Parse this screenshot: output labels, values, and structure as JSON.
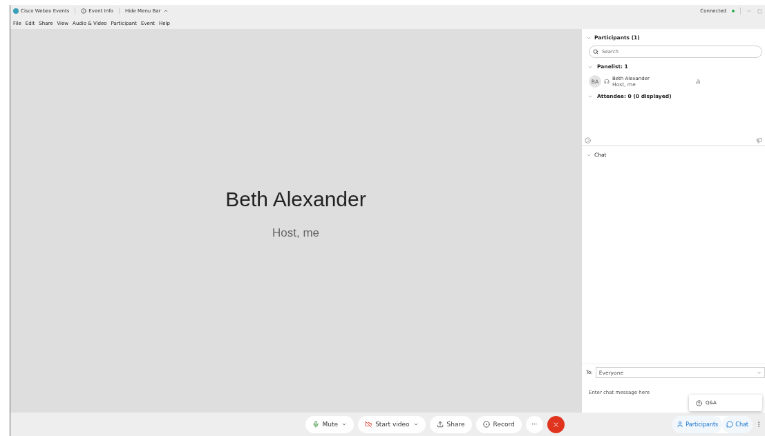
{
  "title_bar": {
    "app_name": "Cisco Webex Events",
    "event_info": "Event Info",
    "hide_menu": "Hide Menu Bar",
    "status": "Connected"
  },
  "menu": [
    "File",
    "Edit",
    "Share",
    "View",
    "Audio & Video",
    "Participant",
    "Event",
    "Help"
  ],
  "stage": {
    "name": "Beth Alexander",
    "role": "Host, me"
  },
  "participants": {
    "title": "Participants (1)",
    "expanded": true,
    "search_placeholder": "Search",
    "groups": [
      {
        "label": "Panelist: 1",
        "expanded": true,
        "members": [
          {
            "initials": "BA",
            "name": "Beth Alexander",
            "role": "Host, me"
          }
        ]
      },
      {
        "label": "Attendee: 0 (0 displayed)",
        "expanded": true
      }
    ]
  },
  "chat": {
    "title": "Chat",
    "expanded": true,
    "to_label": "To:",
    "to_value": "Everyone",
    "placeholder": "Enter chat message here"
  },
  "popup": {
    "label": "Q&A"
  },
  "controls": [
    {
      "kind": "mute",
      "label": "Mute",
      "dropdown": true
    },
    {
      "kind": "video",
      "label": "Start video",
      "dropdown": true
    },
    {
      "kind": "share",
      "label": "Share",
      "dropdown": false
    },
    {
      "kind": "record",
      "label": "Record",
      "dropdown": false
    },
    {
      "kind": "more",
      "label": "···",
      "dropdown": false
    },
    {
      "kind": "leave",
      "dropdown": false
    }
  ],
  "panel_tabs": [
    {
      "kind": "participants",
      "label": "Participants",
      "selected": true
    },
    {
      "kind": "chat",
      "label": "Chat",
      "selected": true
    }
  ]
}
